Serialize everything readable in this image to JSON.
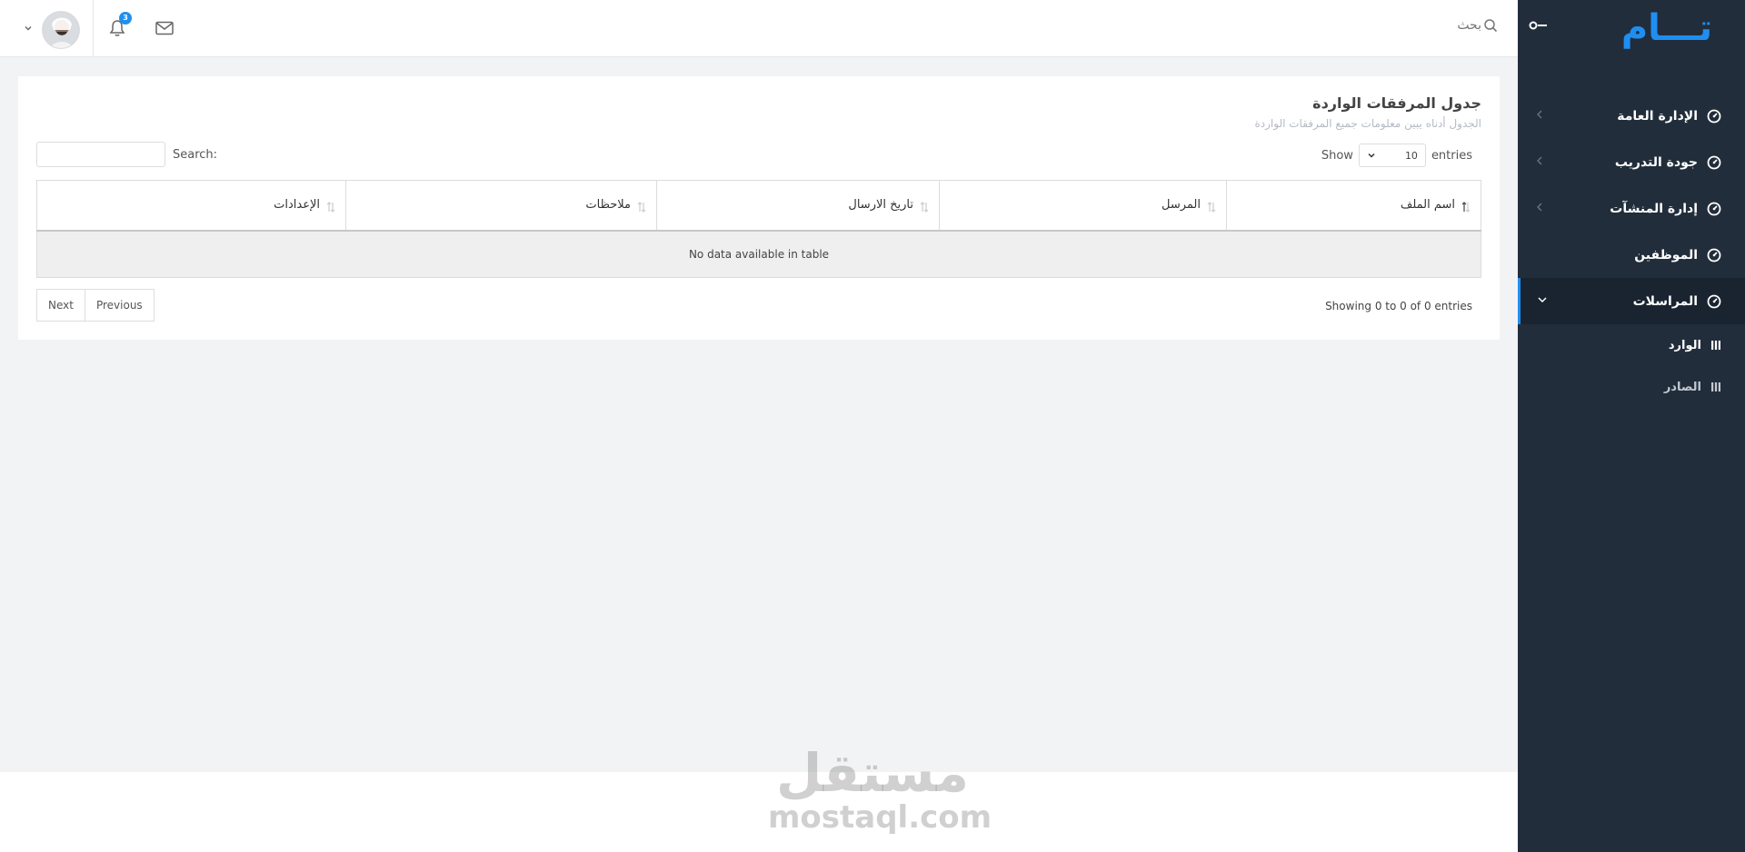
{
  "brand": {
    "logo_text": "تـــام",
    "accent": "#1f8ef1",
    "sidebar_bg": "#222d3c"
  },
  "header": {
    "search_placeholder": "بحث",
    "notification_count": "3",
    "icons": [
      "search-icon",
      "mail-icon",
      "bell-icon",
      "avatar",
      "chevron-down-icon"
    ]
  },
  "sidebar": {
    "items": [
      {
        "label": "الإدارة العامة",
        "icon": "gauge-icon",
        "expandable": true
      },
      {
        "label": "جودة التدريب",
        "icon": "gauge-icon",
        "expandable": true
      },
      {
        "label": "إدارة المنشآت",
        "icon": "gauge-icon",
        "expandable": true
      },
      {
        "label": "الموظفين",
        "icon": "gauge-icon",
        "expandable": false
      },
      {
        "label": "المراسلات",
        "icon": "gauge-icon",
        "expandable": true,
        "active": true
      }
    ],
    "subitems": [
      {
        "label": "الوارد",
        "active": true
      },
      {
        "label": "الصادر",
        "active": false
      }
    ]
  },
  "card": {
    "title": "جدول المرفقات الواردة",
    "subtitle": "الجدول أدناه يبين معلومات جميع المرفقات الواردة",
    "length": {
      "show": "Show",
      "value": "10",
      "entries": "entries"
    },
    "search_label": "Search:",
    "columns": [
      "اسم الملف",
      "المرسل",
      "تاريخ الارسال",
      "ملاحظات",
      "الإعدادات"
    ],
    "empty_message": "No data available in table",
    "info": "Showing 0 to 0 of 0 entries",
    "pager": {
      "previous": "Previous",
      "next": "Next"
    }
  },
  "watermark": {
    "ar": "مستقل",
    "en": "mostaql.com"
  }
}
